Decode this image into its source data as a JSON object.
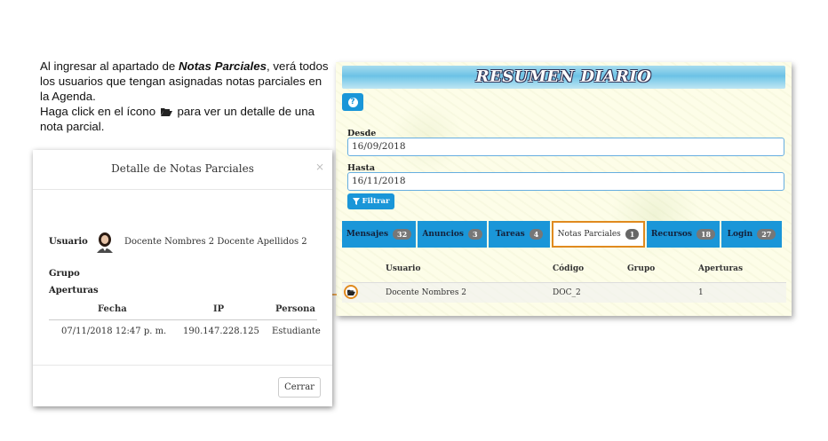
{
  "instructions": {
    "line1_prefix": "Al ingresar al apartado de ",
    "line1_emphasis": "Notas Parciales",
    "line1_suffix": ", verá todos los usuarios que tengan asignadas notas parciales en la Agenda.",
    "line2_prefix": "Haga click en el ícono",
    "line2_suffix": " para ver un detalle de una nota parcial.",
    "folder_icon": "folder-open-icon"
  },
  "panel": {
    "title": "RESUMEN DIARIO",
    "help_icon": "question-icon",
    "desde_label": "Desde",
    "desde_value": "16/09/2018",
    "hasta_label": "Hasta",
    "hasta_value": "16/11/2018",
    "filter_label": "Filtrar",
    "tabs": [
      {
        "label": "Mensajes",
        "count": "32"
      },
      {
        "label": "Anuncios",
        "count": "3"
      },
      {
        "label": "Tareas",
        "count": "4"
      },
      {
        "label": "Notas Parciales",
        "count": "1"
      },
      {
        "label": "Recursos",
        "count": "18"
      },
      {
        "label": "Login",
        "count": "27"
      }
    ],
    "active_tab": "Notas Parciales",
    "columns": [
      "Usuario",
      "Código",
      "Grupo",
      "Aperturas"
    ],
    "rows": [
      {
        "usuario": "Docente Nombres 2",
        "codigo": "DOC_2",
        "grupo": "",
        "aperturas": "1"
      }
    ]
  },
  "modal": {
    "title": "Detalle de Notas Parciales",
    "close_symbol": "×",
    "usuario_label": "Usuario",
    "usuario_value": "Docente Nombres 2 Docente Apellidos 2",
    "grupo_label": "Grupo",
    "aperturas_label": "Aperturas",
    "table_headers": [
      "Fecha",
      "IP",
      "Persona"
    ],
    "table_rows": [
      {
        "fecha": "07/11/2018 12:47 p. m.",
        "ip": "190.147.228.125",
        "persona": "Estudiante"
      }
    ],
    "close_button": "Cerrar"
  },
  "colors": {
    "accent_blue": "#1a96d8",
    "highlight_orange": "#e08a1e",
    "badge_gray": "#777777"
  }
}
